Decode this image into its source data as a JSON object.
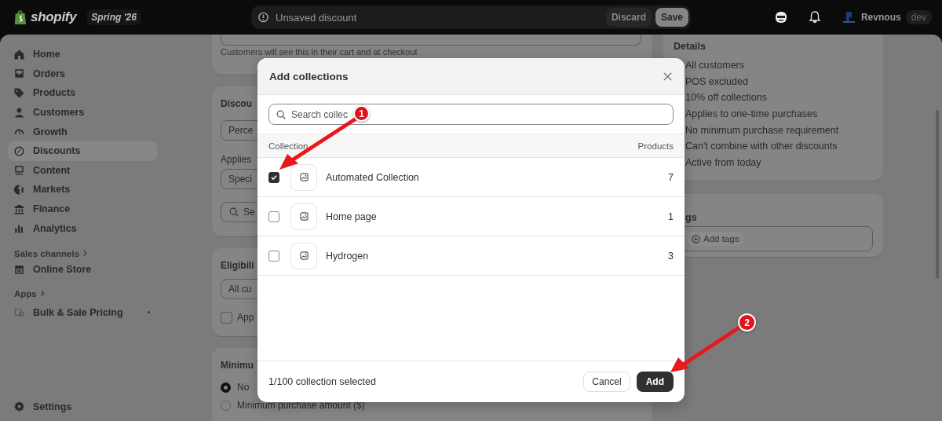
{
  "top_bar": {
    "logo": "shopify",
    "edition": "Spring '26",
    "notice": "Unsaved discount",
    "buttons": [
      "Discard",
      "Save"
    ],
    "store": "Revnous",
    "store_badge": "dev"
  },
  "sidebar": {
    "items": [
      {
        "label": "Home",
        "selected": false
      },
      {
        "label": "Orders",
        "selected": false
      },
      {
        "label": "Products",
        "selected": false
      },
      {
        "label": "Customers",
        "selected": false
      },
      {
        "label": "Growth",
        "selected": false
      },
      {
        "label": "Discounts",
        "selected": true
      },
      {
        "label": "Content",
        "selected": false
      },
      {
        "label": "Markets",
        "selected": false
      },
      {
        "label": "Finance",
        "selected": false
      },
      {
        "label": "Analytics",
        "selected": false
      }
    ],
    "sales_channels": {
      "heading": "Sales channels",
      "items": [
        "Online Store"
      ]
    },
    "apps": {
      "heading": "Apps",
      "items": [
        "Bulk & Sale Pricing"
      ]
    },
    "settings": "Settings"
  },
  "main": {
    "message_hint": "Customers will see this in their cart and at checkout",
    "discount_card": {
      "title": "Discou",
      "value_field": "Perce",
      "applies_label": "Applies",
      "applies_field": "Speci",
      "search_placeholder": "Se"
    },
    "eligibility": {
      "title": "Eligibili",
      "field": "All cu",
      "checkbox": {
        "label": "App",
        "checked": false
      }
    },
    "minimum": {
      "title": "Minimu",
      "options": [
        {
          "label": "No",
          "selected": true
        },
        {
          "label": "Minimum purchase amount ($)",
          "selected": false
        }
      ]
    }
  },
  "details": {
    "title": "Details",
    "items": [
      "All customers",
      "POS excluded",
      "10% off collections",
      "Applies to one-time purchases",
      "No minimum purchase requirement",
      "Can't combine with other discounts",
      "Active from today"
    ]
  },
  "tags": {
    "title": "gs",
    "button": "Add tags"
  },
  "modal": {
    "title": "Add collections",
    "search_placeholder": "Search collec",
    "columns": [
      "Collection",
      "Products"
    ],
    "rows": [
      {
        "name": "Automated Collection",
        "products": "7",
        "checked": true
      },
      {
        "name": "Home page",
        "products": "1",
        "checked": false
      },
      {
        "name": "Hydrogen",
        "products": "3",
        "checked": false
      }
    ],
    "selection_text": "1/100 collection selected",
    "buttons": [
      "Cancel",
      "Add"
    ]
  },
  "annotations": [
    {
      "label": "1"
    },
    {
      "label": "2"
    }
  ]
}
